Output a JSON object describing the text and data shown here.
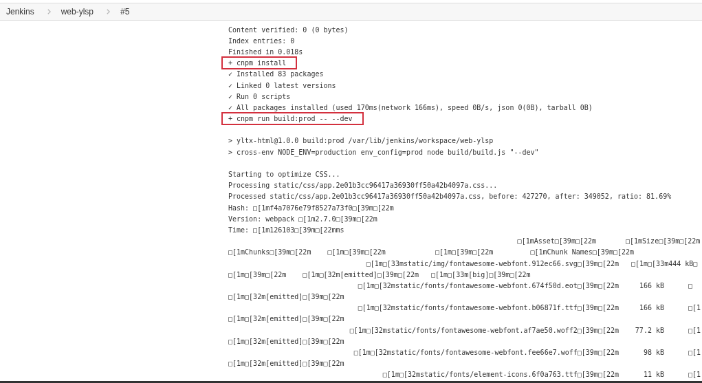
{
  "breadcrumbs": [
    {
      "label": "Jenkins"
    },
    {
      "label": "web-ylsp"
    },
    {
      "label": "#5"
    }
  ],
  "console": {
    "blocks": [
      {
        "lines": [
          {
            "kind": "text",
            "text": "Content verified: 0 (0 bytes)"
          },
          {
            "kind": "text",
            "text": "Index entries: 0"
          },
          {
            "kind": "text",
            "text": "Finished in 0.018s"
          },
          {
            "kind": "command",
            "text": "+ cnpm install",
            "highlighted": true
          },
          {
            "kind": "text",
            "text": "✓ Installed 83 packages"
          },
          {
            "kind": "text",
            "text": "✓ Linked 0 latest versions"
          },
          {
            "kind": "text",
            "text": "✓ Run 0 scripts"
          },
          {
            "kind": "text",
            "text": "✓ All packages installed (used 170ms(network 166ms), speed 0B/s, json 0(0B), tarball 0B)"
          },
          {
            "kind": "command",
            "text": "+ cnpm run build:prod -- --dev",
            "highlighted": true
          }
        ]
      },
      {
        "lines": [
          {
            "kind": "text",
            "text": "> yltx-html@1.0.0 build:prod /var/lib/jenkins/workspace/web-ylsp"
          },
          {
            "kind": "text",
            "text": "> cross-env NODE_ENV=production env_config=prod node build/build.js \"--dev\""
          }
        ]
      },
      {
        "lines": [
          {
            "kind": "text",
            "text": "Starting to optimize CSS..."
          },
          {
            "kind": "text",
            "text": "Processing static/css/app.2e01b3cc96417a36930ff50a42b4097a.css..."
          },
          {
            "kind": "text",
            "text": "Processed static/css/app.2e01b3cc96417a36930ff50a42b4097a.css, before: 427270, after: 349052, ratio: 81.69%"
          },
          {
            "kind": "text",
            "text": "Hash: □[1mf4a7076e79f8527a73f0□[39m□[22m"
          },
          {
            "kind": "text",
            "text": "Version: webpack □[1m2.7.0□[39m□[22m"
          },
          {
            "kind": "text",
            "text": "Time: □[1m126103□[39m□[22mms"
          },
          {
            "kind": "asset_header",
            "asset": "□[1mAsset□[39m□[22m",
            "size": "□[1mSize□[39m□[22m"
          },
          {
            "kind": "text",
            "text": "□[1mChunks□[39m□[22m    □[1m□[39m□[22m            □[1m□[39m□[22m         □[1mChunk Names□[39m□[22m"
          },
          {
            "kind": "asset_row",
            "asset": "□[1m□[33mstatic/img/fontawesome-webfont.912ec66.svg□[39m□[22m",
            "size": "□[1m□[33m444 kB□"
          },
          {
            "kind": "text",
            "text": "□[1m□[39m□[22m    □[1m□[32m[emitted]□[39m□[22m   □[1m□[33m[big]□[39m□[22m"
          },
          {
            "kind": "asset_row",
            "asset": "□[1m□[32mstatic/fonts/fontawesome-webfont.674f50d.eot□[39m□[22m",
            "size": "166 kB",
            "chunks": "□"
          },
          {
            "kind": "text",
            "text": "□[1m□[32m[emitted]□[39m□[22m"
          },
          {
            "kind": "asset_row",
            "asset": "□[1m□[32mstatic/fonts/fontawesome-webfont.b06871f.ttf□[39m□[22m",
            "size": "166 kB",
            "chunks": "□[1"
          },
          {
            "kind": "text",
            "text": "□[1m□[32m[emitted]□[39m□[22m"
          },
          {
            "kind": "asset_row",
            "asset": "□[1m□[32mstatic/fonts/fontawesome-webfont.af7ae50.woff2□[39m□[22m",
            "size": "77.2 kB",
            "chunks": "□[1"
          },
          {
            "kind": "text",
            "text": "□[1m□[32m[emitted]□[39m□[22m"
          },
          {
            "kind": "asset_row",
            "asset": "□[1m□[32mstatic/fonts/fontawesome-webfont.fee66e7.woff□[39m□[22m",
            "size": "98 kB",
            "chunks": "□[1"
          },
          {
            "kind": "text",
            "text": "□[1m□[32m[emitted]□[39m□[22m"
          },
          {
            "kind": "asset_row",
            "asset": "□[1m□[32mstatic/fonts/element-icons.6f0a763.ttf□[39m□[22m",
            "size": "11 kB",
            "chunks": "□[1"
          }
        ]
      }
    ]
  }
}
